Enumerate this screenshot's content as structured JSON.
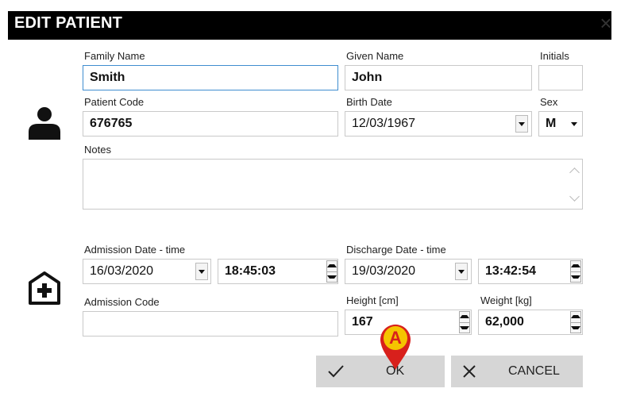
{
  "dialog": {
    "title": "EDIT PATIENT",
    "close_glyph": "×"
  },
  "icons": {
    "patient": "person-icon",
    "admission": "medical-house-icon",
    "marker": "annotation-marker-icon"
  },
  "patient": {
    "family_name": {
      "label": "Family Name",
      "value": "Smith"
    },
    "given_name": {
      "label": "Given Name",
      "value": "John"
    },
    "initials": {
      "label": "Initials",
      "value": ""
    },
    "patient_code": {
      "label": "Patient Code",
      "value": "676765"
    },
    "birth_date": {
      "label": "Birth Date",
      "value": "12/03/1967"
    },
    "sex": {
      "label": "Sex",
      "value": "M"
    },
    "notes": {
      "label": "Notes",
      "value": ""
    }
  },
  "admission": {
    "admission_dt": {
      "label": "Admission Date - time",
      "date": "16/03/2020",
      "time": "18:45:03"
    },
    "discharge_dt": {
      "label": "Discharge Date - time",
      "date": "19/03/2020",
      "time": "13:42:54"
    },
    "admission_code": {
      "label": "Admission Code",
      "value": ""
    },
    "height": {
      "label": "Height [cm]",
      "value": "167"
    },
    "weight": {
      "label": "Weight [kg]",
      "value": "62,000"
    }
  },
  "buttons": {
    "ok": "OK",
    "cancel": "CANCEL"
  },
  "marker": {
    "letter": "A",
    "color": "#f5c400"
  }
}
